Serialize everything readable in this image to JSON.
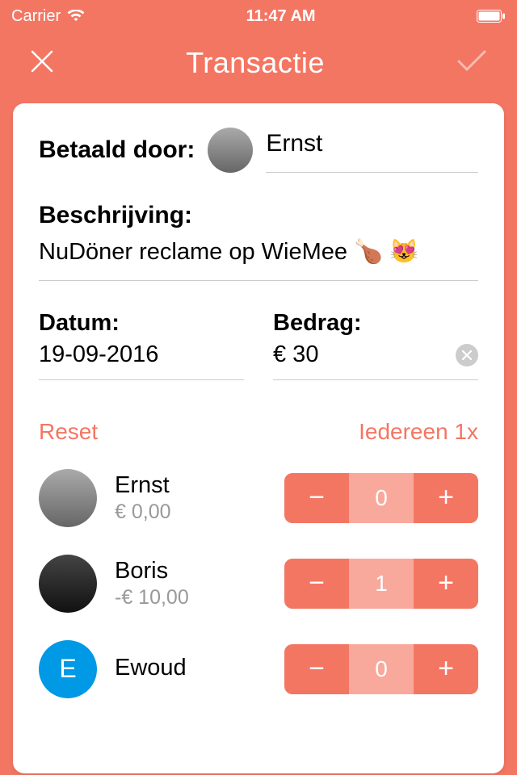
{
  "statusBar": {
    "carrier": "Carrier",
    "time": "11:47 AM"
  },
  "nav": {
    "title": "Transactie"
  },
  "paidBy": {
    "label": "Betaald door:",
    "name": "Ernst"
  },
  "description": {
    "label": "Beschrijving:",
    "value": "NuDöner reclame op WieMee 🍗 😻"
  },
  "date": {
    "label": "Datum:",
    "value": "19-09-2016"
  },
  "amount": {
    "label": "Bedrag:",
    "value": "€ 30"
  },
  "actions": {
    "reset": "Reset",
    "everyone": "Iedereen 1x"
  },
  "participants": [
    {
      "name": "Ernst",
      "balance": "€ 0,00",
      "count": "0",
      "avatarLetter": "",
      "avatarColor": ""
    },
    {
      "name": "Boris",
      "balance": "-€ 10,00",
      "count": "1",
      "avatarLetter": "",
      "avatarColor": ""
    },
    {
      "name": "Ewoud",
      "balance": "",
      "count": "0",
      "avatarLetter": "E",
      "avatarColor": "blue"
    }
  ]
}
